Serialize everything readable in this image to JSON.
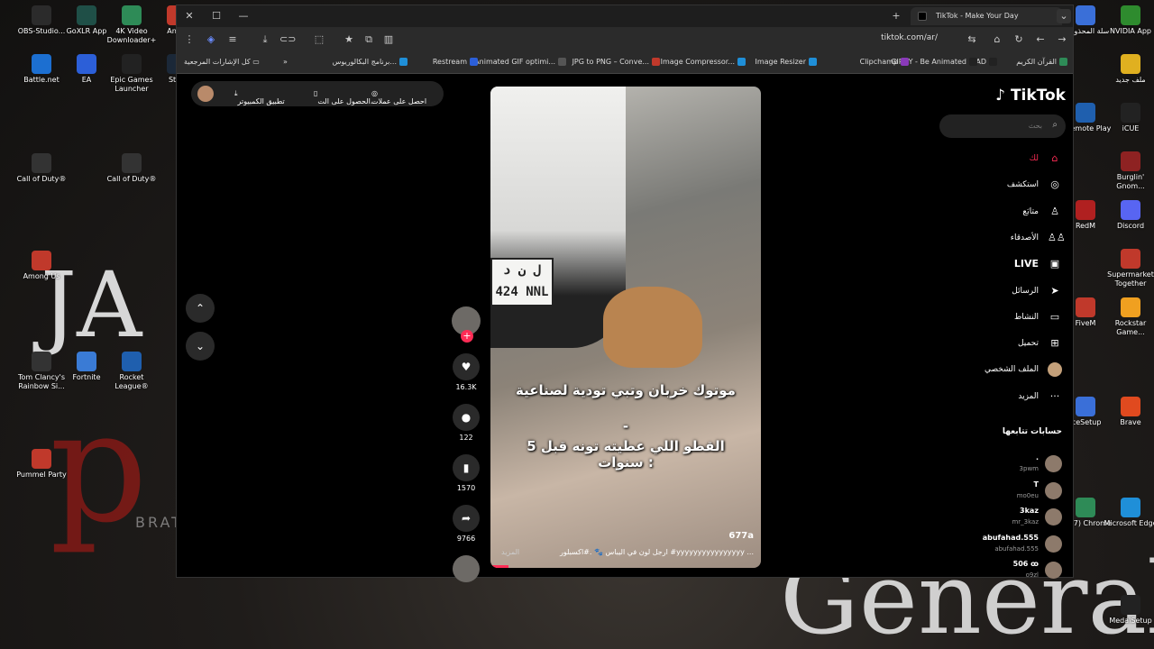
{
  "desktop": {
    "left_icons": [
      {
        "label": "OBS-Studio...",
        "color": "#2b2b2b"
      },
      {
        "label": "GoXLR App",
        "color": "#1f4f47"
      },
      {
        "label": "4K Video Downloader+",
        "color": "#2e8b57"
      },
      {
        "label": "AnyD",
        "color": "#c0392b"
      },
      {
        "label": "Battle.net",
        "color": "#1c6fd1"
      },
      {
        "label": "EA",
        "color": "#2c5fd8"
      },
      {
        "label": "Epic Games Launcher",
        "color": "#222"
      },
      {
        "label": "Stea",
        "color": "#1b2838"
      },
      {
        "label": "Call of Duty®",
        "color": "#333"
      },
      {
        "label": "Call of Duty®",
        "color": "#333"
      },
      {
        "label": "Among Us",
        "color": "#c0392b"
      },
      {
        "label": "Tom Clancy's Rainbow Si...",
        "color": "#333"
      },
      {
        "label": "Fortnite",
        "color": "#3a7bd5"
      },
      {
        "label": "Rocket League®",
        "color": "#1f5fae"
      },
      {
        "label": "Pummel Party",
        "color": "#c0392b"
      }
    ],
    "right_icons": [
      {
        "label": "سلة المحذوفات",
        "color": "#3a6fd8"
      },
      {
        "label": "NVIDIA App",
        "color": "#2e8b2e"
      },
      {
        "label": "ملف جديد",
        "color": "#e0b020"
      },
      {
        "label": "s Remote Play",
        "color": "#1f5fae"
      },
      {
        "label": "iCUE",
        "color": "#222"
      },
      {
        "label": "Burglin' Gnom...",
        "color": "#8e2222"
      },
      {
        "label": "RedM",
        "color": "#b02020"
      },
      {
        "label": "Discord",
        "color": "#5865f2"
      },
      {
        "label": "Supermarket Together",
        "color": "#c0392b"
      },
      {
        "label": "FiveM",
        "color": "#c0392b"
      },
      {
        "label": "Rockstar Game...",
        "color": "#f0a020"
      },
      {
        "label": "iceSetup",
        "color": "#3a6fd8"
      },
      {
        "label": "Brave",
        "color": "#e04a1f"
      },
      {
        "label": "(RM7) Chrome",
        "color": "#2e8b57"
      },
      {
        "label": "Microsoft Edge",
        "color": "#1f8fd8"
      },
      {
        "label": "MedalSetup",
        "color": "#222"
      }
    ],
    "wallpaper_text": {
      "j": "JA",
      "p": "p",
      "arc": "BRATEU",
      "general": "General"
    }
  },
  "browser": {
    "tab_title": "TikTok - Make Your Day",
    "url": "tiktok.com/ar/",
    "window_controls": {
      "close": "✕",
      "maximize": "☐",
      "minimize": "—",
      "new_tab": "+",
      "tab_list": "⌄"
    },
    "bookmarks": [
      {
        "label": "القرآن الكريم",
        "color": "#2e8b57"
      },
      {
        "label": "AD",
        "color": "#222"
      },
      {
        "label": "GIPHY - Be Animated",
        "color": "#222"
      },
      {
        "label": "Clipchamp",
        "color": "#8a3ab9"
      },
      {
        "label": "Image Resizer",
        "color": "#1f8fd8"
      },
      {
        "label": "Image Compressor...",
        "color": "#1f8fd8"
      },
      {
        "label": "JPG to PNG – Conve...",
        "color": "#c0392b"
      },
      {
        "label": "Animated GIF optimi...",
        "color": "#555"
      },
      {
        "label": "Restream",
        "color": "#2c5fd8"
      },
      {
        "label": "برنامج البكالوريوس...",
        "color": "#1f8fd8"
      }
    ],
    "bookmarks_overflow": "»",
    "all_bookmarks": "كل الإشارات المرجعية"
  },
  "tiktok": {
    "logo": "TikTok",
    "search_placeholder": "بحث",
    "get_bar": {
      "coins": "احصل على عملات",
      "get_app": "الحصول على الت...",
      "desktop_app": "تطبيق الكمبيوتر"
    },
    "nav": [
      {
        "label": "لك",
        "icon": "home-icon",
        "glyph": "⌂",
        "active": true
      },
      {
        "label": "استكشف",
        "icon": "compass-icon",
        "glyph": "◎"
      },
      {
        "label": "متابَع",
        "icon": "user-follow-icon",
        "glyph": "♙"
      },
      {
        "label": "الأصدقاء",
        "icon": "friends-icon",
        "glyph": "♙♙"
      },
      {
        "label": "LIVE",
        "icon": "live-icon",
        "glyph": "▣"
      },
      {
        "label": "الرسائل",
        "icon": "send-icon",
        "glyph": "➤"
      },
      {
        "label": "النشاط",
        "icon": "activity-icon",
        "glyph": "▭"
      },
      {
        "label": "تحميل",
        "icon": "upload-icon",
        "glyph": "⊞"
      },
      {
        "label": "الملف الشخصي",
        "icon": "avatar-icon",
        "glyph": ""
      },
      {
        "label": "المزيد",
        "icon": "more-icon",
        "glyph": "···"
      }
    ],
    "following_title": "حسابات تتابعها",
    "following": [
      {
        "name": ".",
        "user": "3pwm"
      },
      {
        "name": "T",
        "user": "mo0eu"
      },
      {
        "name": "3kaz",
        "user": "mr_3kaz"
      },
      {
        "name": "abufahad.555",
        "user": "abufahad.555"
      },
      {
        "name": "506 ꝏ",
        "user": "o9zl"
      }
    ],
    "video": {
      "plate_top": "ل ن د",
      "plate_bottom": "424 NNL",
      "caption_1": "موتوك خربان وتبي تودية لصناعية",
      "caption_sep": "-",
      "caption_2": "القطو اللي عطيته تونه قبل 5 سنوات :",
      "username": "677a",
      "description": "ارجل لون في اليباس 🐾 .#اكسبلور #yyyyyyyyyyyyyyyy ...",
      "more": "المزيد"
    },
    "actions": [
      {
        "icon": "heart-icon",
        "glyph": "♥",
        "count": "16.3K"
      },
      {
        "icon": "comment-icon",
        "glyph": "●",
        "count": "122"
      },
      {
        "icon": "bookmark-icon",
        "glyph": "▮",
        "count": "1570"
      },
      {
        "icon": "share-icon",
        "glyph": "➦",
        "count": "9766"
      }
    ],
    "nav_up": "⌃",
    "nav_down": "⌄"
  }
}
